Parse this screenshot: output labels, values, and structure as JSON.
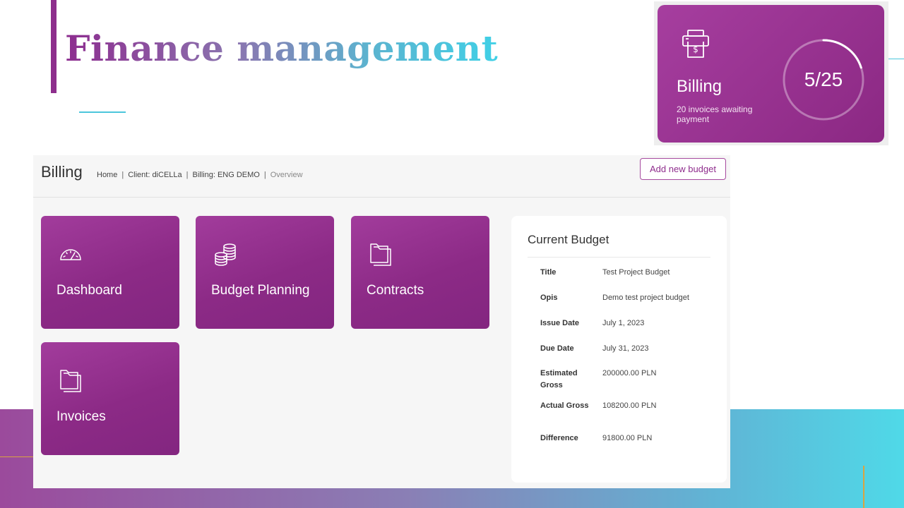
{
  "slide": {
    "title": "Finance management"
  },
  "widget": {
    "title": "Billing",
    "subtitle": "20 invoices awaiting payment",
    "progress_text": "5/25",
    "progress_fraction": 0.2,
    "icon": "invoice-printer-icon"
  },
  "app": {
    "title": "Billing",
    "breadcrumb": [
      "Home",
      "Client: diCELLa",
      "Billing: ENG DEMO",
      "Overview"
    ],
    "add_button_label": "Add new budget",
    "tiles": [
      {
        "label": "Dashboard",
        "icon": "speedometer-icon"
      },
      {
        "label": "Budget Planning",
        "icon": "coins-icon"
      },
      {
        "label": "Contracts",
        "icon": "folder-icon"
      },
      {
        "label": "Invoices",
        "icon": "folder-icon"
      }
    ],
    "budget": {
      "title": "Current Budget",
      "rows": [
        {
          "key": "Title",
          "value": "Test Project Budget"
        },
        {
          "key": "Opis",
          "value": "Demo test project budget"
        },
        {
          "key": "Issue Date",
          "value": "July 1, 2023"
        },
        {
          "key": "Due Date",
          "value": "July 31, 2023"
        },
        {
          "key": "Estimated Gross",
          "value": "200000.00 PLN"
        },
        {
          "key": "Actual Gross",
          "value": "108200.00 PLN"
        },
        {
          "key": "Difference",
          "value": "91800.00 PLN"
        }
      ]
    }
  },
  "colors": {
    "brand_purple": "#8e2f8d",
    "accent_teal": "#4cc6dc",
    "accent_gold": "#d9a441"
  }
}
